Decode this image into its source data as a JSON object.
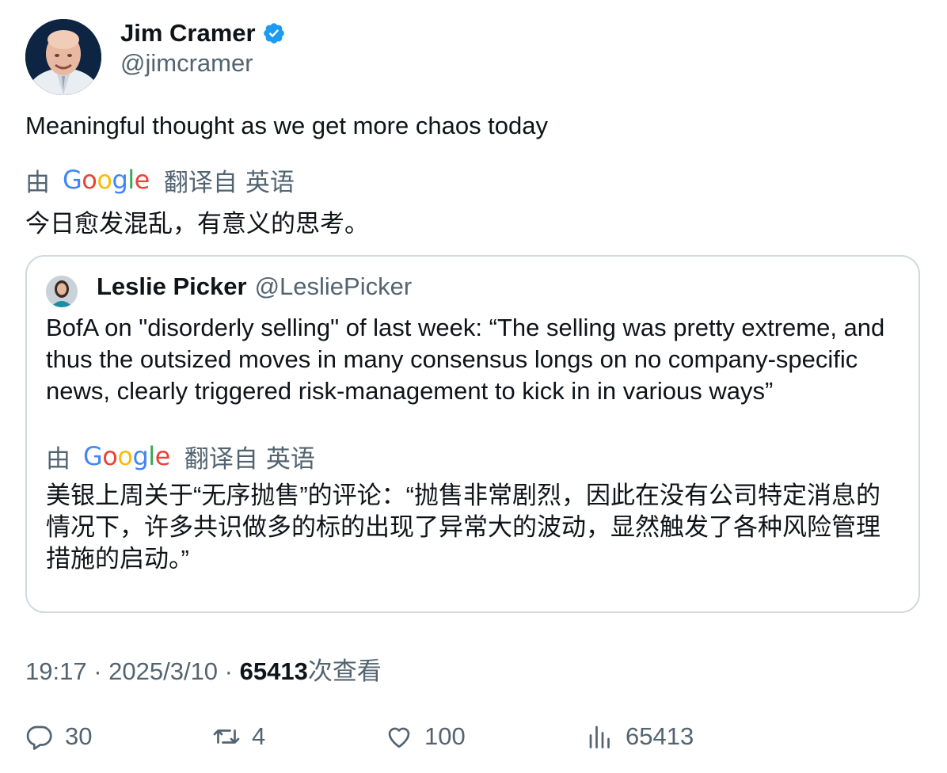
{
  "author": {
    "display_name": "Jim Cramer",
    "handle": "@jimcramer",
    "verified": true,
    "verified_color": "#1d9bf0"
  },
  "tweet": {
    "text": "Meaningful thought as we get more chaos today",
    "translation": {
      "by_label": "由",
      "provider": "Google",
      "from_label": "翻译自",
      "language": "英语",
      "text": "今日愈发混乱，有意义的思考。"
    }
  },
  "quote": {
    "author_name": "Leslie Picker",
    "author_handle": "@LesliePicker",
    "text": "BofA on \"disorderly selling\" of last week: “The selling was pretty extreme, and thus the outsized moves in many consensus longs on no company-specific news, clearly triggered risk-management to kick in in various ways”",
    "translation": {
      "by_label": "由",
      "provider": "Google",
      "from_label": "翻译自",
      "language": "英语",
      "text": "美银上周关于“无序抛售”的评论：“抛售非常剧烈，因此在没有公司特定消息的情况下，许多共识做多的标的出现了异常大的波动，显然触发了各种风险管理措施的启动。”"
    }
  },
  "meta": {
    "time": "19:17",
    "separator": " · ",
    "date": "2025/3/10",
    "views_count": "65413",
    "views_label": "次查看"
  },
  "actions": {
    "replies": "30",
    "retweets": "4",
    "likes": "100",
    "views": "65413"
  },
  "colors": {
    "text_primary": "#0f1419",
    "text_secondary": "#536471",
    "border": "#cfd9de"
  }
}
